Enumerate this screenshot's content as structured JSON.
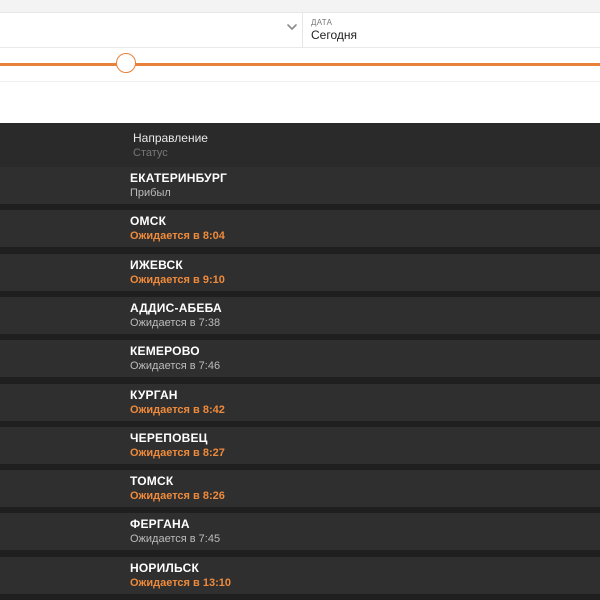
{
  "filters": {
    "date_label": "ДАТА",
    "date_value": "Сегодня"
  },
  "slider": {
    "position_fraction": 0.21
  },
  "board": {
    "column_title": "Направление",
    "column_subtitle": "Статус",
    "rows": [
      {
        "city": "ЕКАТЕРИНБУРГ",
        "status": "Прибыл",
        "highlight": false
      },
      {
        "city": "ОМСК",
        "status": "Ожидается в 8:04",
        "highlight": true
      },
      {
        "city": "ИЖЕВСК",
        "status": "Ожидается в 9:10",
        "highlight": true
      },
      {
        "city": "АДДИС-АБЕБА",
        "status": "Ожидается в 7:38",
        "highlight": false
      },
      {
        "city": "КЕМЕРОВО",
        "status": "Ожидается в 7:46",
        "highlight": false
      },
      {
        "city": "КУРГАН",
        "status": "Ожидается в 8:42",
        "highlight": true
      },
      {
        "city": "ЧЕРЕПОВЕЦ",
        "status": "Ожидается в 8:27",
        "highlight": true
      },
      {
        "city": "ТОМСК",
        "status": "Ожидается в 8:26",
        "highlight": true
      },
      {
        "city": "ФЕРГАНА",
        "status": "Ожидается в 7:45",
        "highlight": false
      },
      {
        "city": "НОРИЛЬСК",
        "status": "Ожидается в 13:10",
        "highlight": true
      }
    ]
  },
  "colors": {
    "accent": "#e8823a",
    "delayed_text": "#ee8a3c",
    "board_bg": "#1f1f1f",
    "row_bg": "#2f2f2f"
  },
  "icons": {
    "dropdown": "chevron-down-icon"
  }
}
